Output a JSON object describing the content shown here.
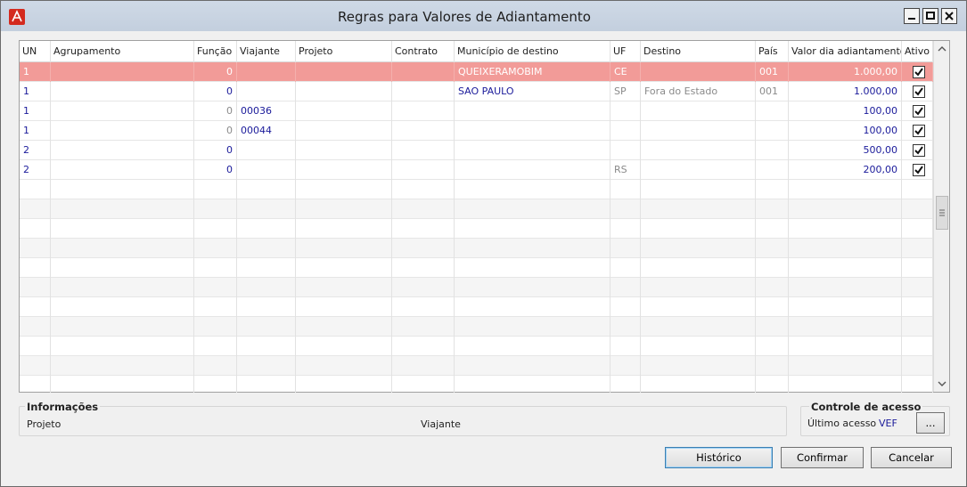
{
  "window": {
    "title": "Regras para Valores de Adiantamento",
    "colors": {
      "selected_row": "#f29b98",
      "value_text": "#1a1a9a",
      "muted_text": "#8a8a8a"
    }
  },
  "grid": {
    "columns": [
      {
        "key": "un",
        "label": "UN"
      },
      {
        "key": "agrupamento",
        "label": "Agrupamento"
      },
      {
        "key": "funcao",
        "label": "Função"
      },
      {
        "key": "viajante",
        "label": "Viajante"
      },
      {
        "key": "projeto",
        "label": "Projeto"
      },
      {
        "key": "contrato",
        "label": "Contrato"
      },
      {
        "key": "municipio",
        "label": "Município de destino"
      },
      {
        "key": "uf",
        "label": "UF"
      },
      {
        "key": "destino",
        "label": "Destino"
      },
      {
        "key": "pais",
        "label": "País"
      },
      {
        "key": "valor",
        "label": "Valor dia adiantamento"
      },
      {
        "key": "ativo",
        "label": "Ativo"
      }
    ],
    "rows": [
      {
        "un": "1",
        "agrupamento": "",
        "funcao": "0",
        "viajante": "",
        "projeto": "",
        "contrato": "",
        "municipio": "QUEIXERAMOBIM",
        "uf": "CE",
        "destino": "",
        "pais": "001",
        "valor": "1.000,00",
        "ativo": true,
        "selected": true
      },
      {
        "un": "1",
        "agrupamento": "",
        "funcao": "0",
        "viajante": "",
        "projeto": "",
        "contrato": "",
        "municipio": "SAO PAULO",
        "uf": "SP",
        "destino": "Fora do Estado",
        "pais": "001",
        "valor": "1.000,00",
        "ativo": true,
        "selected": false
      },
      {
        "un": "1",
        "agrupamento": "",
        "funcao": "0",
        "viajante": "00036",
        "projeto": "",
        "contrato": "",
        "municipio": "",
        "uf": "",
        "destino": "",
        "pais": "",
        "valor": "100,00",
        "ativo": true,
        "selected": false
      },
      {
        "un": "1",
        "agrupamento": "",
        "funcao": "0",
        "viajante": "00044",
        "projeto": "",
        "contrato": "",
        "municipio": "",
        "uf": "",
        "destino": "",
        "pais": "",
        "valor": "100,00",
        "ativo": true,
        "selected": false
      },
      {
        "un": "2",
        "agrupamento": "",
        "funcao": "0",
        "viajante": "",
        "projeto": "",
        "contrato": "",
        "municipio": "",
        "uf": "",
        "destino": "",
        "pais": "",
        "valor": "500,00",
        "ativo": true,
        "selected": false
      },
      {
        "un": "2",
        "agrupamento": "",
        "funcao": "0",
        "viajante": "",
        "projeto": "",
        "contrato": "",
        "municipio": "",
        "uf": "RS",
        "destino": "",
        "pais": "",
        "valor": "200,00",
        "ativo": true,
        "selected": false
      }
    ]
  },
  "info": {
    "title": "Informações",
    "projeto_label": "Projeto",
    "viajante_label": "Viajante"
  },
  "access": {
    "title": "Controle de acesso",
    "last_access_label": "Último acesso",
    "last_access_value": "VEF",
    "more_button": "..."
  },
  "buttons": {
    "historico": "Histórico",
    "confirmar": "Confirmar",
    "cancelar": "Cancelar"
  }
}
